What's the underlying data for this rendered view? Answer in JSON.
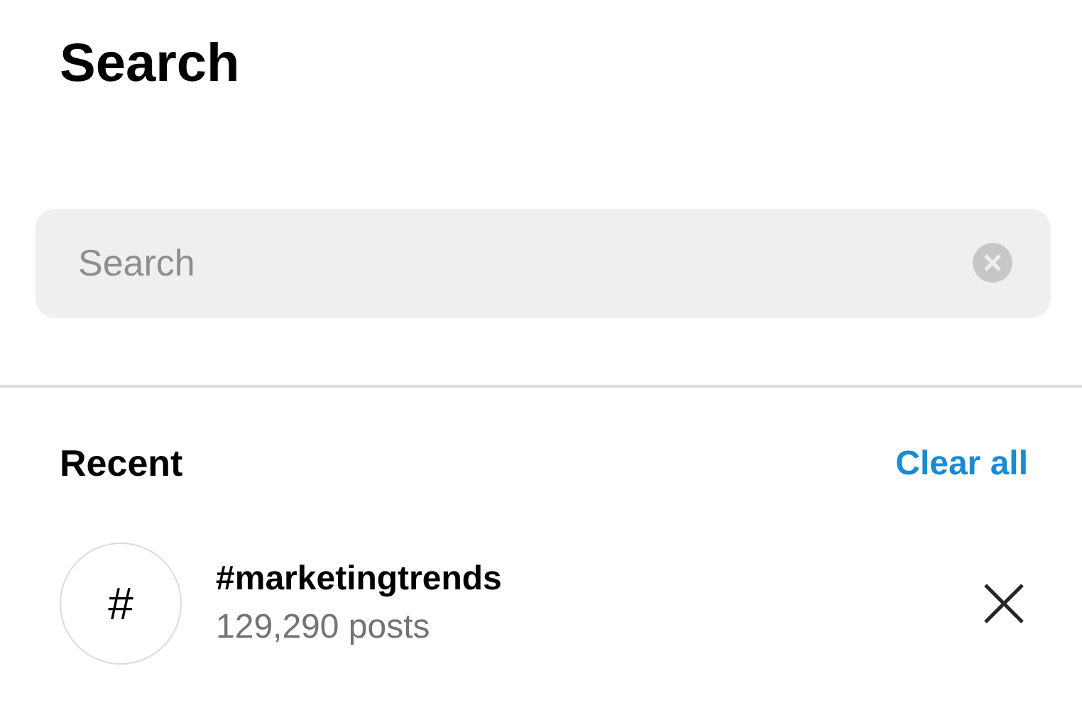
{
  "title": "Search",
  "search": {
    "placeholder": "Search"
  },
  "recent": {
    "heading": "Recent",
    "clear_label": "Clear all",
    "items": [
      {
        "kind": "hashtag",
        "icon_text": "#",
        "name": "#marketingtrends",
        "subtitle": "129,290 posts"
      }
    ]
  }
}
